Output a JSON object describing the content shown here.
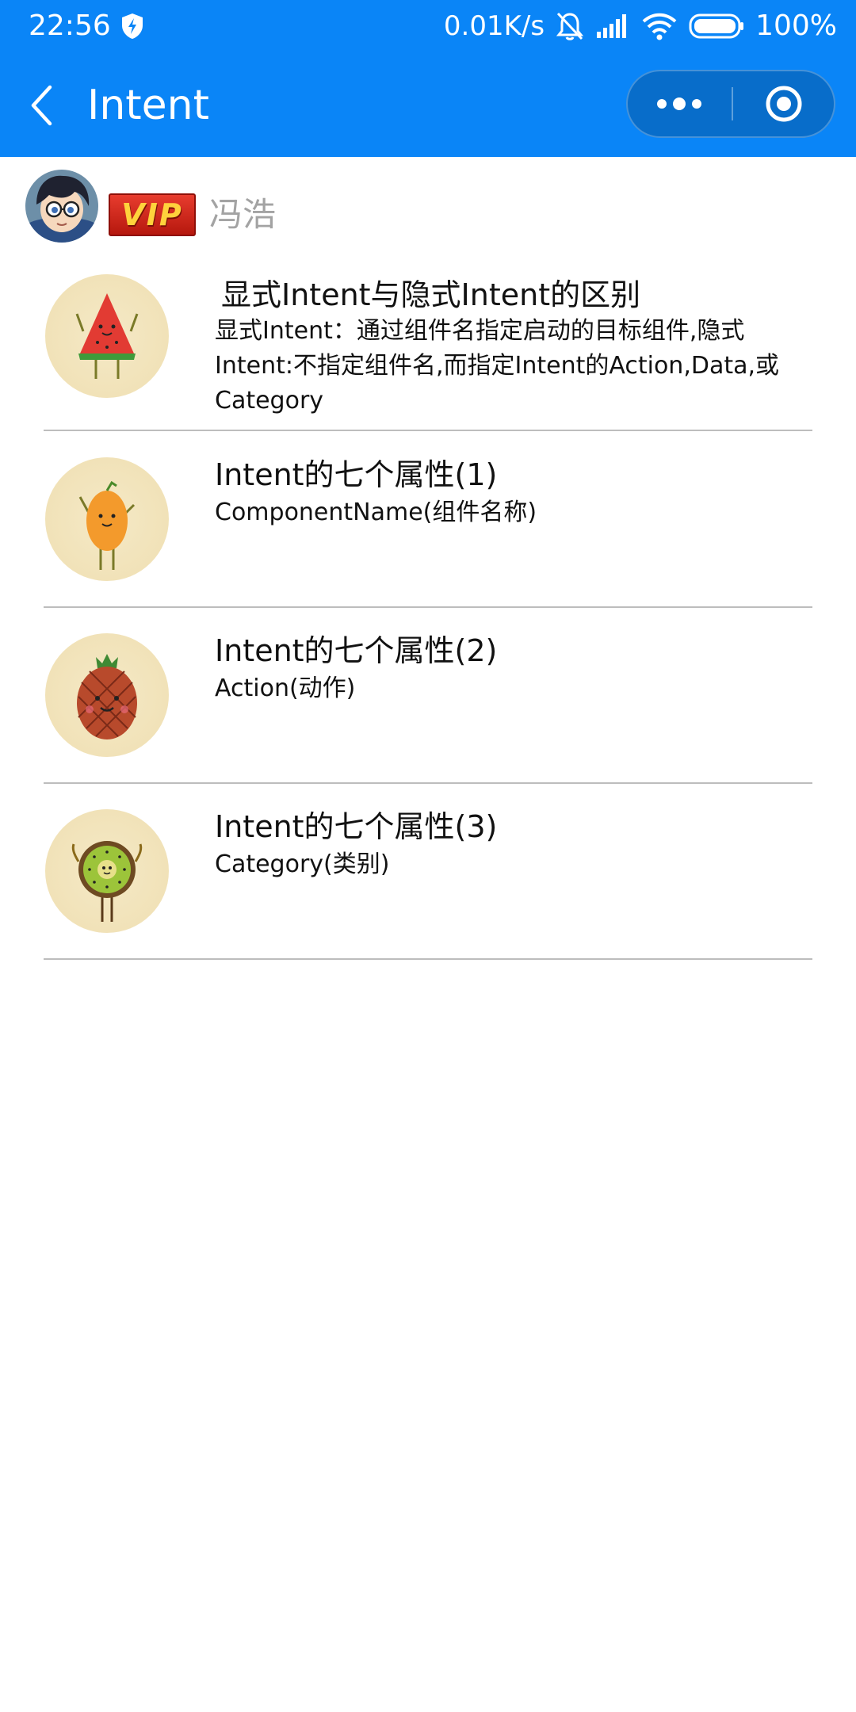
{
  "status_bar": {
    "time": "22:56",
    "network_speed": "0.01K/s",
    "battery": "100%"
  },
  "header": {
    "title": "Intent"
  },
  "user": {
    "badge": "VIP",
    "name": "冯浩"
  },
  "items": [
    {
      "title": "显式Intent与隐式Intent的区别",
      "description": "显式Intent：通过组件名指定启动的目标组件,隐式Intent:不指定组件名,而指定Intent的Action,Data,或Category",
      "icon": "watermelon-character-icon"
    },
    {
      "title": "Intent的七个属性(1)",
      "description": "ComponentName(组件名称)",
      "icon": "mango-character-icon"
    },
    {
      "title": "Intent的七个属性(2)",
      "description": "Action(动作)",
      "icon": "pineapple-character-icon"
    },
    {
      "title": "Intent的七个属性(3)",
      "description": "Category(类别)",
      "icon": "kiwi-character-icon"
    }
  ],
  "colors": {
    "header_bg": "#0a85f7",
    "separator": "#bdbdbd",
    "username": "#a3a3a3"
  }
}
